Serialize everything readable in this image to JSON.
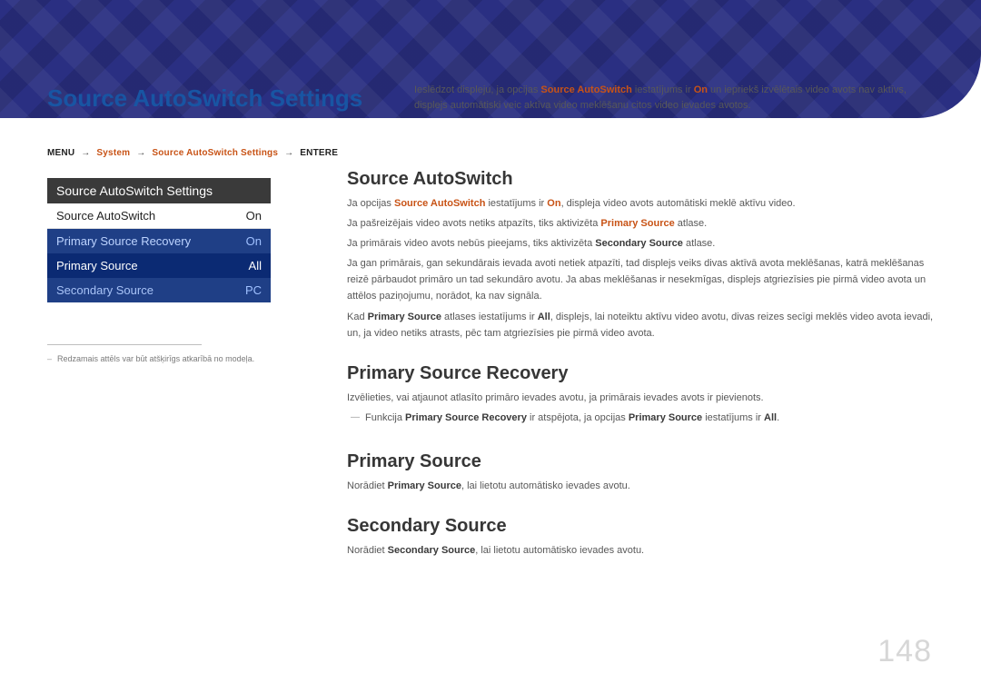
{
  "page_title": "Source AutoSwitch Settings",
  "intro_prefix": "Ieslēdzot displeju, ja opcijas ",
  "intro_hl1": "Source AutoSwitch",
  "intro_mid1": " iestatījums ir ",
  "intro_hl2": "On",
  "intro_suffix": " un iepriekš izvēlētais video avots nav aktīvs, displejs automātiski veic aktīva video meklēšanu citos video ievades avotos.",
  "crumb_menu": "MENU",
  "crumb_menu_icon": " 𝕄",
  "crumb_system": "System",
  "crumb_arrow": "→",
  "crumb_current": "Source AutoSwitch Settings",
  "crumb_enter": "ENTER",
  "crumb_enter_e": "E",
  "menu": {
    "title": "Source AutoSwitch Settings",
    "row1_label": "Source AutoSwitch",
    "row1_value": "On",
    "row2_label": "Primary Source Recovery",
    "row2_value": "On",
    "row3_label": "Primary Source",
    "row3_value": "All",
    "row4_label": "Secondary Source",
    "row4_value": "PC"
  },
  "footnote_dash": "–",
  "footnote_text": "Redzamais attēls var būt atšķirīgs atkarībā no modeļa.",
  "s1_h": "Source AutoSwitch",
  "s1_p1a": "Ja opcijas ",
  "s1_p1_hl1": "Source AutoSwitch",
  "s1_p1b": " iestatījums ir ",
  "s1_p1_hl2": "On",
  "s1_p1c": ", displeja video avots automātiski meklē aktīvu video.",
  "s1_p2a": "Ja pašreizējais video avots netiks atpazīts, tiks aktivizēta ",
  "s1_p2_hl": "Primary Source",
  "s1_p2b": " atlase.",
  "s1_p3a": "Ja primārais video avots nebūs pieejams, tiks aktivizēta ",
  "s1_p3_b": "Secondary Source",
  "s1_p3b": " atlase.",
  "s1_p4": "Ja gan primārais, gan sekundārais ievada avoti netiek atpazīti, tad displejs veiks divas aktīvā avota meklēšanas, katrā meklēšanas reizē pārbaudot primāro un tad sekundāro avotu. Ja abas meklēšanas ir nesekmīgas, displejs atgriezīsies pie pirmā video avota un attēlos paziņojumu, norādot, ka nav signāla.",
  "s1_p5a": "Kad ",
  "s1_p5_b1": "Primary Source",
  "s1_p5b": " atlases iestatījums ir ",
  "s1_p5_b2": "All",
  "s1_p5c": ", displejs, lai noteiktu aktīvu video avotu, divas reizes secīgi meklēs video avota ievadi, un, ja video netiks atrasts, pēc tam atgriezīsies pie pirmā video avota.",
  "s2_h": "Primary Source Recovery",
  "s2_p1": "Izvēlieties, vai atjaunot atlasīto primāro ievades avotu, ja primārais ievades avots ir pievienots.",
  "s2_sub_a": "Funkcija ",
  "s2_sub_b1": "Primary Source Recovery",
  "s2_sub_b": " ir atspējota, ja opcijas ",
  "s2_sub_b2": "Primary Source",
  "s2_sub_c": " iestatījums ir ",
  "s2_sub_b3": "All",
  "s2_sub_d": ".",
  "s3_h": "Primary Source",
  "s3_p_a": "Norādiet ",
  "s3_p_b": "Primary Source",
  "s3_p_c": ", lai lietotu automātisko ievades avotu.",
  "s4_h": "Secondary Source",
  "s4_p_a": "Norādiet ",
  "s4_p_b": "Secondary Source",
  "s4_p_c": ", lai lietotu automātisko ievades avotu.",
  "page_number": "148"
}
